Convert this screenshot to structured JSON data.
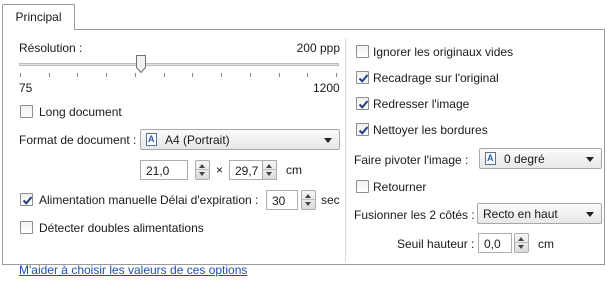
{
  "tabs": [
    {
      "label": "Principal"
    }
  ],
  "resolution": {
    "label": "Résolution :",
    "value_text": "200 ppp",
    "min_label": "75",
    "max_label": "1200",
    "min": 75,
    "max": 1200,
    "value": 200
  },
  "long_document": {
    "label": "Long document",
    "checked": false
  },
  "document_format": {
    "label": "Format de document :",
    "selected": "A4 (Portrait)",
    "width": "21,0",
    "times": "×",
    "height": "29,7",
    "unit": "cm"
  },
  "manual_feed": {
    "label": "Alimentation manuelle",
    "checked": true
  },
  "timeout": {
    "label": "Délai d'expiration :",
    "value": "30",
    "unit": "sec"
  },
  "double_feed": {
    "label": "Détecter doubles alimentations",
    "checked": false
  },
  "right_options": {
    "ignore_blank": {
      "label": "Ignorer les originaux vides",
      "checked": false
    },
    "crop": {
      "label": "Recadrage sur l'original",
      "checked": true
    },
    "straighten": {
      "label": "Redresser l'image",
      "checked": true
    },
    "clean_borders": {
      "label": "Nettoyer les bordures",
      "checked": true
    }
  },
  "rotate": {
    "label": "Faire pivoter l'image :",
    "selected": "0 degré"
  },
  "flip": {
    "label": "Retourner",
    "checked": false
  },
  "merge_sides": {
    "label": "Fusionner les 2 côtés :",
    "selected": "Recto en haut"
  },
  "threshold": {
    "label": "Seuil hauteur :",
    "value": "0,0",
    "unit": "cm"
  },
  "help_link": "M'aider à choisir les valeurs de ces options",
  "colors": {
    "check": "#1c3f8a",
    "link": "#1a4fb5",
    "border": "#9a9a9a"
  }
}
